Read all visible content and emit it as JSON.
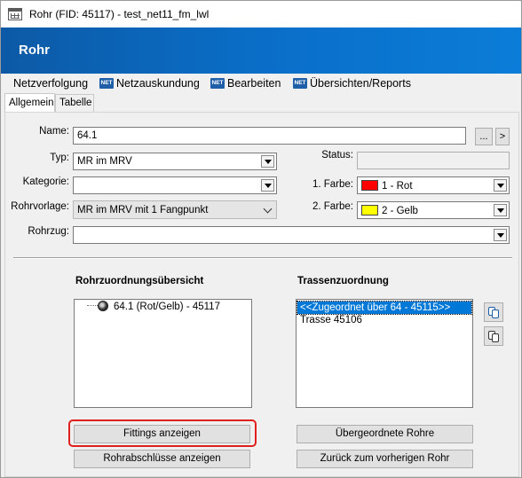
{
  "window": {
    "title": "Rohr (FID: 45117) - test_net11_fm_lwl"
  },
  "banner": {
    "title": "Rohr"
  },
  "menu": [
    {
      "label": "Netzverfolgung",
      "icon": ""
    },
    {
      "label": "Netzauskundung",
      "icon": "net-icon"
    },
    {
      "label": "Bearbeiten",
      "icon": "net-icon"
    },
    {
      "label": "Übersichten/Reports",
      "icon": "net-icon"
    }
  ],
  "net_icon_text": "NET",
  "tabs": [
    {
      "label": "Allgemein",
      "active": true
    },
    {
      "label": "Tabelle",
      "active": false
    }
  ],
  "form": {
    "name_label": "Name:",
    "name_value": "64.1",
    "ellipsis_label": "...",
    "next_label": ">",
    "typ_label": "Typ:",
    "typ_value": "MR im MRV",
    "status_label": "Status:",
    "status_value": "",
    "kategorie_label": "Kategorie:",
    "kategorie_value": "",
    "farbe1_label": "1. Farbe:",
    "farbe1_value": "1 - Rot",
    "farbe1_color": "#ff0000",
    "rohrvorlage_label": "Rohrvorlage:",
    "rohrvorlage_value": "MR im MRV mit 1 Fangpunkt",
    "farbe2_label": "2. Farbe:",
    "farbe2_value": "2 - Gelb",
    "farbe2_color": "#ffff00",
    "rohrzug_label": "Rohrzug:",
    "rohrzug_value": ""
  },
  "rohrzuordnung": {
    "title": "Rohrzuordnungsübersicht",
    "items": [
      "64.1 (Rot/Gelb) - 45117"
    ]
  },
  "trassen": {
    "title": "Trassenzuordnung",
    "items": [
      "<<Zugeordnet über 64 - 45115>>",
      "Trasse 45106"
    ],
    "selected_index": 0
  },
  "buttons": {
    "fittings": "Fittings anzeigen",
    "rohrabschluesse": "Rohrabschlüsse anzeigen",
    "uebergeordnete": "Übergeordnete Rohre",
    "zurueck": "Zurück zum vorherigen Rohr"
  },
  "colors": {
    "accent": "#0a6ec8",
    "selection": "#0078d7",
    "highlight": "#e0201c"
  }
}
